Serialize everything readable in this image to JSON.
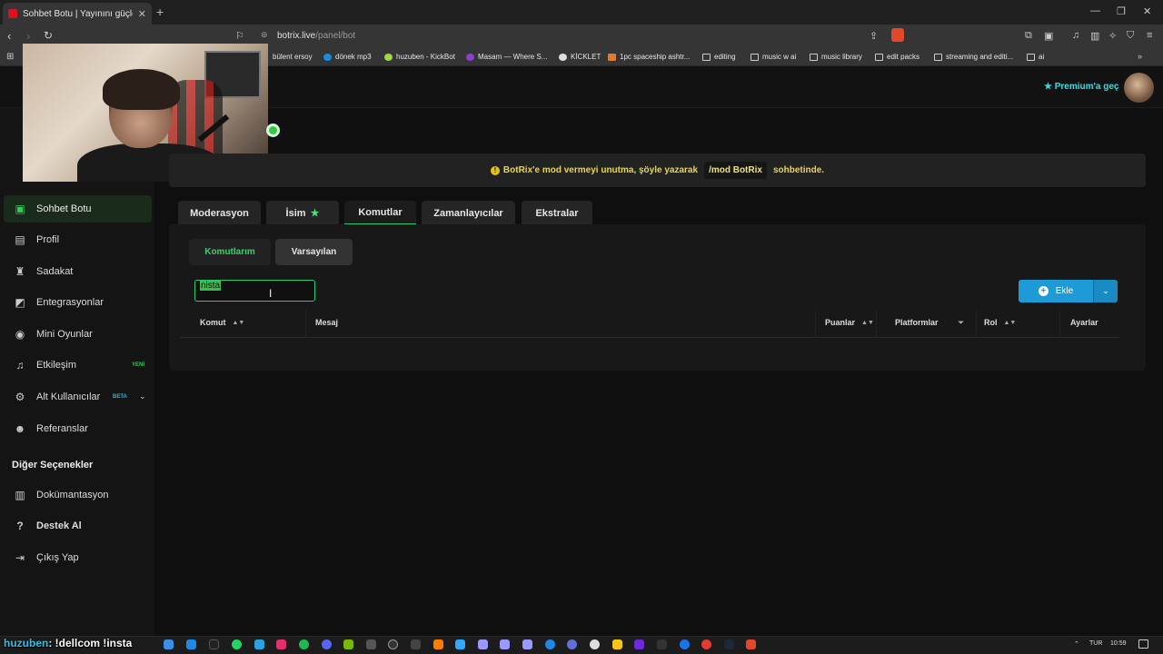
{
  "browser": {
    "tab_title": "Sohbet Botu | Yayınını güçlendir",
    "url_host": "botrix.live",
    "url_path": "/panel/bot",
    "bookmarks": [
      {
        "label": "bülent ersoy",
        "icon": "none"
      },
      {
        "label": "dönek mp3",
        "icon": "colored"
      },
      {
        "label": "huzuben - KickBot",
        "icon": "colored"
      },
      {
        "label": "Masam — Where S...",
        "icon": "colored"
      },
      {
        "label": "KİCKLET",
        "icon": "colored"
      },
      {
        "label": "1pc spaceship ashtr...",
        "icon": "colored"
      },
      {
        "label": "editing",
        "icon": "folder"
      },
      {
        "label": "music w ai",
        "icon": "folder"
      },
      {
        "label": "music library",
        "icon": "folder"
      },
      {
        "label": "edit packs",
        "icon": "folder"
      },
      {
        "label": "streaming and editi...",
        "icon": "folder"
      },
      {
        "label": "ai",
        "icon": "folder"
      }
    ]
  },
  "header": {
    "premium_label": "Premium'a geç"
  },
  "sidebar": {
    "items": [
      {
        "label": "Sohbet Botu",
        "icon": "robot-icon",
        "active": true
      },
      {
        "label": "Profil",
        "icon": "id-card-icon"
      },
      {
        "label": "Sadakat",
        "icon": "trophy-icon"
      },
      {
        "label": "Entegrasyonlar",
        "icon": "puzzle-icon"
      },
      {
        "label": "Mini Oyunlar",
        "icon": "gamepad-icon"
      },
      {
        "label": "Etkileşim",
        "icon": "music-note-icon",
        "badge": "YENİ"
      },
      {
        "label": "Alt Kullanıcılar",
        "icon": "users-cog-icon",
        "badge": "BETA"
      },
      {
        "label": "Referanslar",
        "icon": "users-icon"
      }
    ],
    "section_heading": "Diğer Seçenekler",
    "other_items": [
      {
        "label": "Dokümantasyon",
        "icon": "book-icon"
      },
      {
        "label": "Destek Al",
        "icon": "question-icon"
      },
      {
        "label": "Çıkış Yap",
        "icon": "logout-icon"
      }
    ]
  },
  "notice": {
    "text_before": "BotRix'e mod vermeyi unutma, şöyle yazarak",
    "command": "/mod BotRix",
    "text_after": "sohbetinde."
  },
  "tabs": [
    {
      "label": "Moderasyon"
    },
    {
      "label": "İsim",
      "star": true
    },
    {
      "label": "Komutlar",
      "active": true
    },
    {
      "label": "Zamanlayıcılar"
    },
    {
      "label": "Ekstralar"
    }
  ],
  "subtabs": {
    "mine": "Komutlarım",
    "defaults": "Varsayılan"
  },
  "search": {
    "value": "nista"
  },
  "add_button": {
    "label": "Ekle"
  },
  "table": {
    "columns": {
      "command": "Komut",
      "message": "Mesaj",
      "points": "Puanlar",
      "platforms": "Platformlar",
      "role": "Rol",
      "settings": "Ayarlar"
    }
  },
  "overlay": {
    "user": "huzuben",
    "message": ": !dellcom !insta"
  },
  "taskbar": {
    "language": "TUR",
    "time": "10:59"
  },
  "colors": {
    "accent_green": "#2ecc71",
    "premium_cyan": "#2de0e6",
    "notice_yellow": "#e8d64a",
    "add_blue": "#1e9bd7"
  }
}
